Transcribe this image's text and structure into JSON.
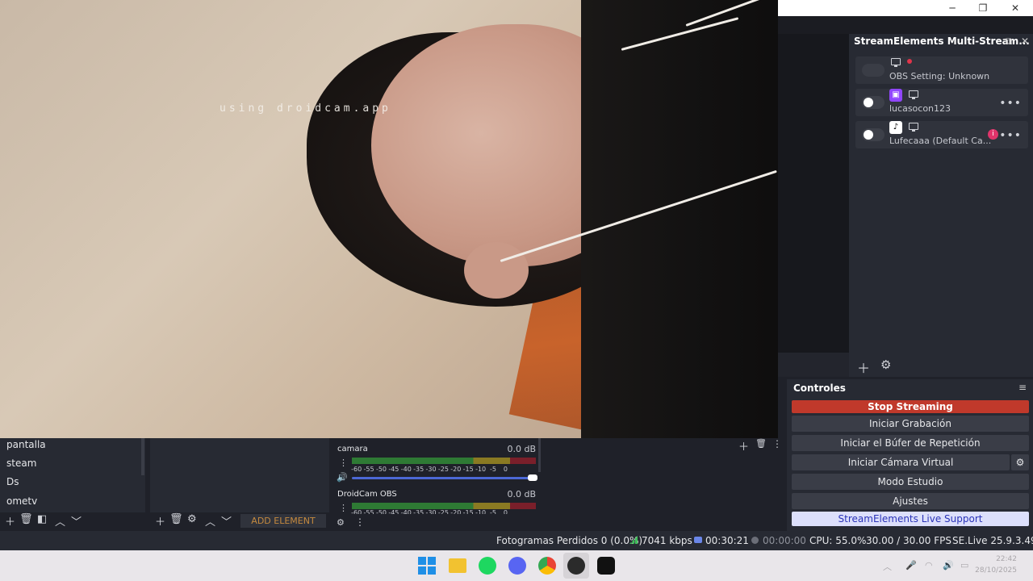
{
  "preview": {
    "watermark": "using droidcam.app"
  },
  "window": {
    "minimize": "─",
    "maximize": "❐",
    "close": "✕"
  },
  "dock": {
    "title": "StreamElements Multi-Stream...",
    "rows": [
      {
        "name": "OBS Setting: Unknown"
      },
      {
        "name": "lucasocon123"
      },
      {
        "name": "Lufecaaa (Default Ca..."
      }
    ]
  },
  "controls": {
    "title": "Controles",
    "stop": "Stop Streaming",
    "record": "Iniciar Grabación",
    "replay": "Iniciar el Búfer de Repetición",
    "virtual_cam": "Iniciar Cámara Virtual",
    "studio": "Modo Estudio",
    "settings": "Ajustes",
    "support": "StreamElements Live Support"
  },
  "scenes": {
    "items": [
      "pantalla",
      "steam",
      "Ds",
      "ometv"
    ]
  },
  "sources": {
    "add_element": "ADD ELEMENT"
  },
  "mixer": {
    "ticks": [
      "-60",
      "-55",
      "-50",
      "-45",
      "-40",
      "-35",
      "-30",
      "-25",
      "-20",
      "-15",
      "-10",
      "-5",
      "0"
    ],
    "channels": [
      {
        "name": "camara",
        "db": "0.0 dB"
      },
      {
        "name": "DroidCam OBS",
        "db": "0.0 dB"
      }
    ]
  },
  "status": {
    "dropped": "Fotogramas Perdidos 0 (0.0%)",
    "kbps": "7041 kbps",
    "stream_time": "00:30:21",
    "record_time": "00:00:00",
    "cpu": "CPU: 55.0%",
    "fps": "30.00 / 30.00 FPS",
    "version": "SE.Live 25.9.3.493"
  },
  "taskbar": {
    "time": "22:42",
    "date": "28/10/2025"
  },
  "colors": {
    "accent": "#4c68d6",
    "stop": "#c0392b",
    "support_bg": "#dcdffb"
  }
}
